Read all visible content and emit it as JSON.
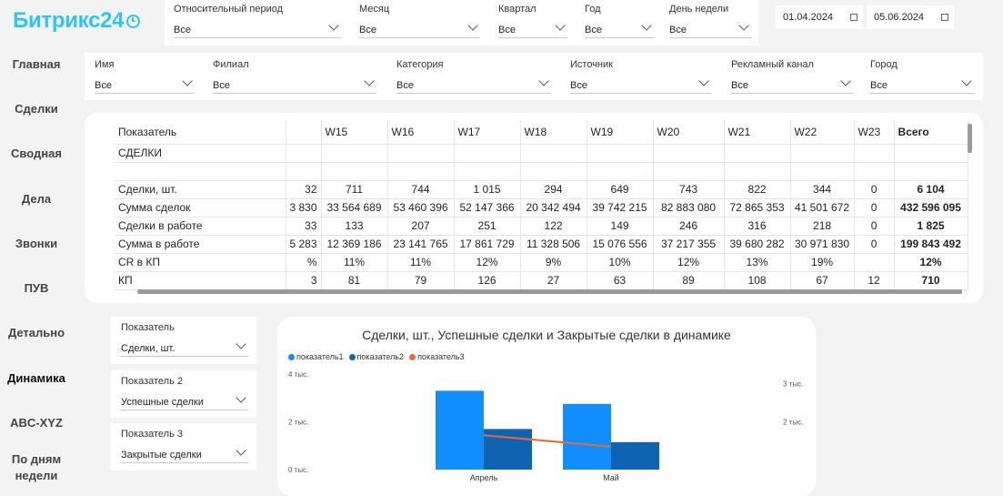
{
  "logo": "Битрикс24",
  "nav": [
    "Главная",
    "Сделки",
    "Сводная",
    "Дела",
    "Звонки",
    "ПУВ",
    "Детально",
    "Динамика",
    "ABC-XYZ",
    "По дням",
    "недели"
  ],
  "filters_top": [
    {
      "label": "Относительный период",
      "value": "Все"
    },
    {
      "label": "Месяц",
      "value": "Все"
    },
    {
      "label": "Квартал",
      "value": "Все"
    },
    {
      "label": "Год",
      "value": "Все"
    },
    {
      "label": "День недели",
      "value": "Все"
    }
  ],
  "dates": {
    "from": "01.04.2024",
    "to": "05.06.2024"
  },
  "filters_second": [
    {
      "label": "Имя",
      "value": "Все"
    },
    {
      "label": "Филиал",
      "value": "Все"
    },
    {
      "label": "Категория",
      "value": "Все"
    },
    {
      "label": "Источник",
      "value": "Все"
    },
    {
      "label": "Рекламный канал",
      "value": "Все"
    },
    {
      "label": "Город",
      "value": "Все"
    }
  ],
  "table": {
    "header": [
      "Показатель",
      "",
      "W15",
      "W16",
      "W17",
      "W18",
      "W19",
      "W20",
      "W21",
      "W22",
      "W23",
      "Всего"
    ],
    "section": "СДЕЛКИ",
    "rows": [
      [
        "Сделки, шт.",
        "32",
        "711",
        "744",
        "1 015",
        "294",
        "649",
        "743",
        "822",
        "344",
        "0",
        "6 104"
      ],
      [
        "Сумма сделок",
        "3 830",
        "33 564 689",
        "53 460 396",
        "52 147 366",
        "20 342 494",
        "39 742 215",
        "82 883 080",
        "72 865 353",
        "41 501 672",
        "0",
        "432 596 095"
      ],
      [
        "Сделки в работе",
        "33",
        "133",
        "207",
        "251",
        "122",
        "149",
        "246",
        "316",
        "218",
        "0",
        "1 825"
      ],
      [
        "Сумма в работе",
        "5 283",
        "12 369 186",
        "23 141 765",
        "17 861 729",
        "11 328 506",
        "15 076 556",
        "37 217 355",
        "39 680 282",
        "30 971 830",
        "0",
        "199 843 492"
      ],
      [
        "CR в КП",
        "%",
        "11%",
        "11%",
        "12%",
        "9%",
        "10%",
        "12%",
        "13%",
        "19%",
        "",
        "12%"
      ],
      [
        "КП",
        "3",
        "81",
        "79",
        "126",
        "27",
        "63",
        "89",
        "108",
        "67",
        "12",
        "710"
      ]
    ]
  },
  "measures": [
    {
      "label": "Показатель",
      "value": "Сделки, шт."
    },
    {
      "label": "Показатель 2",
      "value": "Успешные сделки"
    },
    {
      "label": "Показатель 3",
      "value": "Закрытые сделки"
    }
  ],
  "chart_data": {
    "type": "bar",
    "title": "Сделки, шт., Успешные сделки и Закрытые сделки в динамике",
    "categories": [
      "Апрель",
      "Май"
    ],
    "series": [
      {
        "name": "показатель1",
        "values": [
          3300,
          2750
        ],
        "color": "#118dff"
      },
      {
        "name": "показатель2",
        "values": [
          1700,
          1150
        ],
        "color": "#0e64b0"
      },
      {
        "name": "показатель3",
        "values": [
          1650,
          1350
        ],
        "color": "#e66c37",
        "kind": "line",
        "axis": "right"
      }
    ],
    "y_left": {
      "ticks": [
        "0 тыс.",
        "2 тыс.",
        "4 тыс."
      ],
      "ylim": [
        0,
        4000
      ]
    },
    "y_right": {
      "ticks": [
        "2 тыс.",
        "3 тыс."
      ],
      "ylim": [
        750,
        3250
      ]
    }
  }
}
